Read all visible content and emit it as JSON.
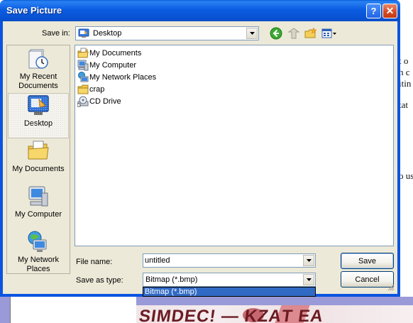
{
  "window": {
    "title": "Save Picture",
    "help_glyph": "?",
    "close_glyph": "✕"
  },
  "save_in": {
    "label": "Save in:",
    "value": "Desktop",
    "icon": "desktop-icon"
  },
  "toolbar": {
    "icons": [
      "back-arrow-icon",
      "up-folder-icon",
      "new-folder-icon",
      "views-menu-icon"
    ]
  },
  "places": [
    {
      "label": "My Recent Documents",
      "icon": "recent-documents-icon"
    },
    {
      "label": "Desktop",
      "icon": "desktop-icon",
      "selected": true
    },
    {
      "label": "My Documents",
      "icon": "my-documents-icon"
    },
    {
      "label": "My Computer",
      "icon": "my-computer-icon"
    },
    {
      "label": "My Network Places",
      "icon": "my-network-places-icon"
    }
  ],
  "files": [
    {
      "name": "My Documents",
      "icon": "my-documents-icon"
    },
    {
      "name": "My Computer",
      "icon": "my-computer-icon"
    },
    {
      "name": "My Network Places",
      "icon": "my-network-places-icon"
    },
    {
      "name": "crap",
      "icon": "folder-icon"
    },
    {
      "name": "CD Drive",
      "icon": "cd-drive-icon"
    }
  ],
  "file_name": {
    "label": "File name:",
    "value": "untitled"
  },
  "save_as_type": {
    "label": "Save as type:",
    "value": "Bitmap (*.bmp)",
    "dropdown_options": [
      "Bitmap (*.bmp)"
    ]
  },
  "buttons": {
    "save": "Save",
    "cancel": "Cancel"
  },
  "background_app": {
    "right_text_fragments": [
      "t o",
      "h c",
      "itin",
      "tat",
      "o us"
    ],
    "image_text": "SIMDEC! — KZАT ЕА"
  },
  "colors": {
    "title_bar": "#0a54e0",
    "dialog_face": "#ece9d8",
    "selection": "#316ac5",
    "background_lavender": "#9a9ad8"
  }
}
